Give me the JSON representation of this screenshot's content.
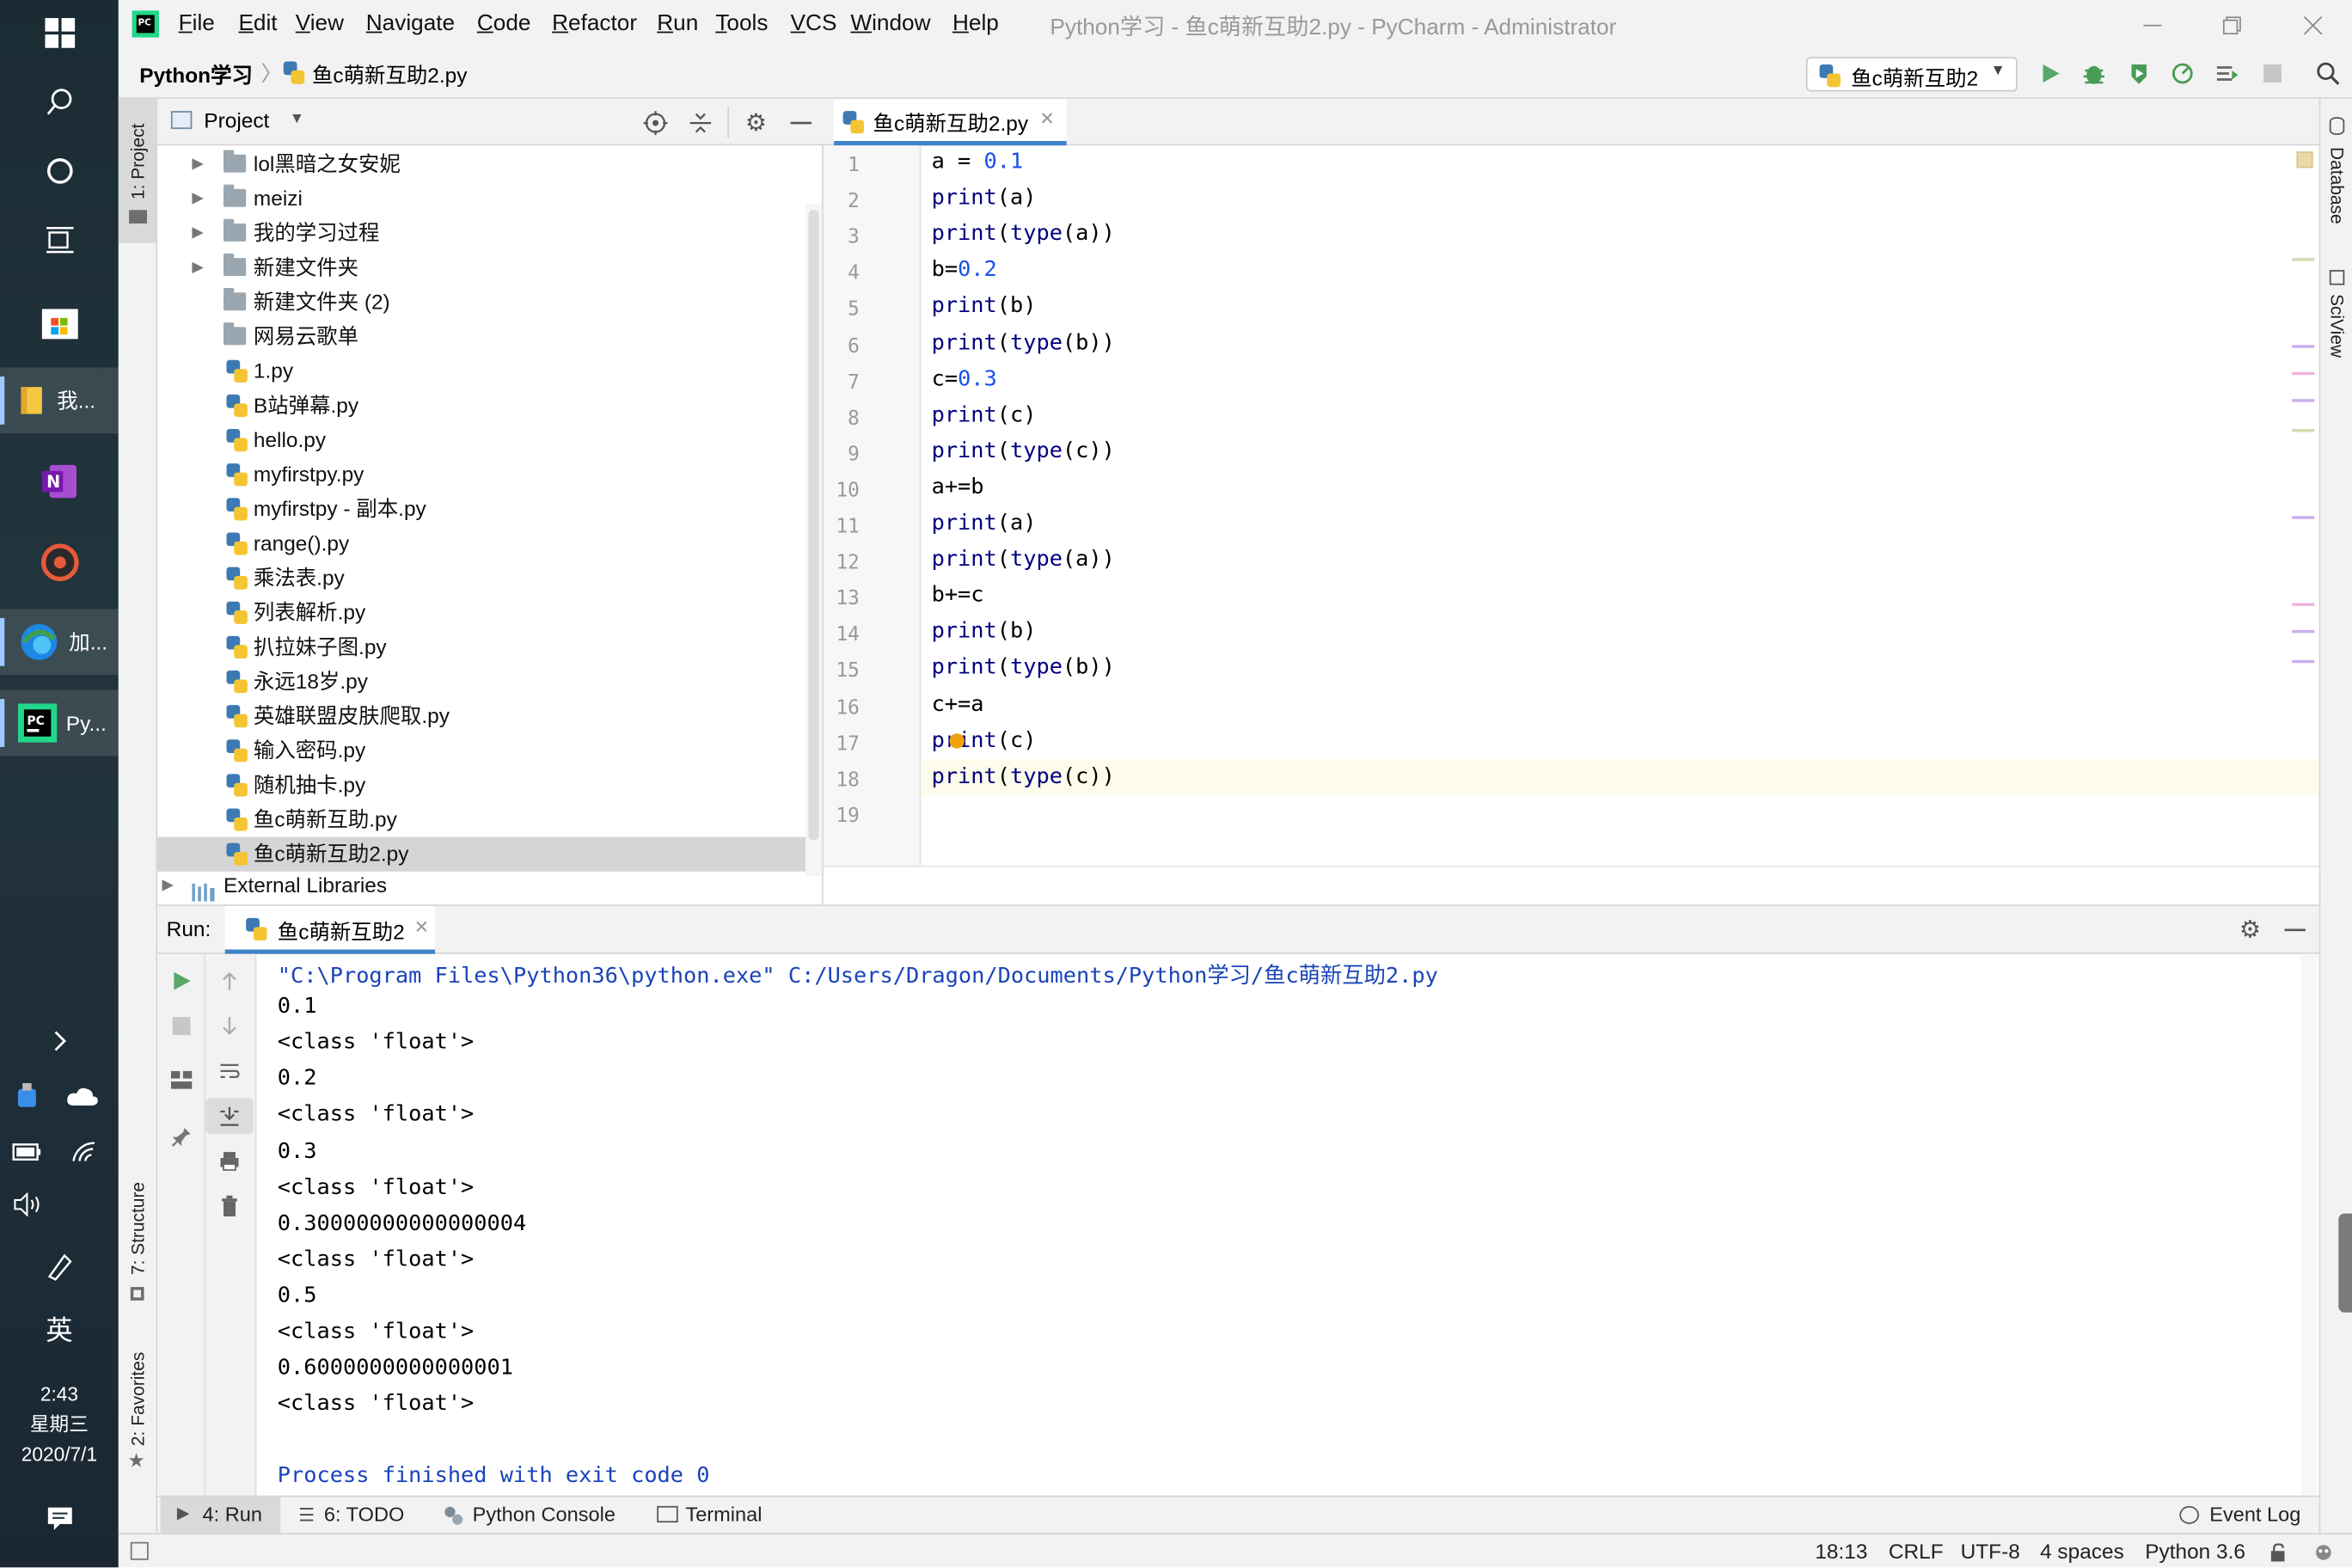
{
  "taskbar": {
    "apps": [
      {
        "label": "我...",
        "icon": "file-explorer-icon"
      },
      {
        "label": "",
        "icon": "onenote-icon"
      },
      {
        "label": "",
        "icon": "music-player-icon"
      },
      {
        "label": "加...",
        "icon": "edge-icon"
      },
      {
        "label": "Py...",
        "icon": "pycharm-icon"
      }
    ],
    "ime": "英",
    "time": "2:43",
    "weekday": "星期三",
    "date": "2020/7/1"
  },
  "titlebar": {
    "menu": [
      {
        "label": "File",
        "u": "F",
        "rest": "ile"
      },
      {
        "label": "Edit",
        "u": "E",
        "rest": "dit"
      },
      {
        "label": "View",
        "u": "V",
        "rest": "iew"
      },
      {
        "label": "Navigate",
        "u": "N",
        "rest": "avigate"
      },
      {
        "label": "Code",
        "u": "C",
        "rest": "ode"
      },
      {
        "label": "Refactor",
        "u": "R",
        "rest": "efactor"
      },
      {
        "label": "Run",
        "u": "R",
        "rest": "un"
      },
      {
        "label": "Tools",
        "u": "T",
        "rest": "ools"
      },
      {
        "label": "VCS",
        "u": "V",
        "rest": "CS"
      },
      {
        "label": "Window",
        "u": "W",
        "rest": "indow"
      },
      {
        "label": "Help",
        "u": "H",
        "rest": "elp"
      }
    ],
    "title": "Python学习 - 鱼c萌新互助2.py - PyCharm - Administrator"
  },
  "navbar": {
    "breadcrumb_project": "Python学习",
    "breadcrumb_file": "鱼c萌新互助2.py",
    "run_config": "鱼c萌新互助2"
  },
  "left_strip": {
    "project_tab": "1: Project",
    "structure_tab": "7: Structure",
    "favorites_tab": "2: Favorites"
  },
  "right_strip": {
    "database_tab": "Database",
    "sciview_tab": "SciView"
  },
  "project_panel": {
    "title": "Project",
    "items": [
      {
        "label": "lol黑暗之女安妮",
        "type": "folder",
        "expandable": true
      },
      {
        "label": "meizi",
        "type": "folder",
        "expandable": true
      },
      {
        "label": "我的学习过程",
        "type": "folder",
        "expandable": true
      },
      {
        "label": "新建文件夹",
        "type": "folder",
        "expandable": true
      },
      {
        "label": "新建文件夹 (2)",
        "type": "folder",
        "expandable": false
      },
      {
        "label": "网易云歌单",
        "type": "folder",
        "expandable": false
      },
      {
        "label": "1.py",
        "type": "py"
      },
      {
        "label": "B站弹幕.py",
        "type": "py"
      },
      {
        "label": "hello.py",
        "type": "py"
      },
      {
        "label": "myfirstpy.py",
        "type": "py"
      },
      {
        "label": "myfirstpy - 副本.py",
        "type": "py"
      },
      {
        "label": "range().py",
        "type": "py"
      },
      {
        "label": "乘法表.py",
        "type": "py"
      },
      {
        "label": "列表解析.py",
        "type": "py"
      },
      {
        "label": "扒拉妹子图.py",
        "type": "py"
      },
      {
        "label": "永远18岁.py",
        "type": "py"
      },
      {
        "label": "英雄联盟皮肤爬取.py",
        "type": "py"
      },
      {
        "label": "输入密码.py",
        "type": "py"
      },
      {
        "label": "随机抽卡.py",
        "type": "py"
      },
      {
        "label": "鱼c萌新互助.py",
        "type": "py"
      },
      {
        "label": "鱼c萌新互助2.py",
        "type": "py",
        "selected": true
      }
    ],
    "external_libraries": "External Libraries"
  },
  "editor": {
    "tab": "鱼c萌新互助2.py",
    "lines": [
      "a = 0.1",
      "print(a)",
      "print(type(a))",
      "b=0.2",
      "print(b)",
      "print(type(b))",
      "c=0.3",
      "print(c)",
      "print(type(c))",
      "a+=b",
      "print(a)",
      "print(type(a))",
      "b+=c",
      "print(b)",
      "print(type(b))",
      "c+=a",
      "print(c)",
      "print(type(c))",
      ""
    ],
    "current_line": 18
  },
  "run_panel": {
    "label": "Run:",
    "tab": "鱼c萌新互助2",
    "output": [
      "\"C:\\Program Files\\Python36\\python.exe\" C:/Users/Dragon/Documents/Python学习/鱼c萌新互助2.py",
      "0.1",
      "<class 'float'>",
      "0.2",
      "<class 'float'>",
      "0.3",
      "<class 'float'>",
      "0.30000000000000004",
      "<class 'float'>",
      "0.5",
      "<class 'float'>",
      "0.6000000000000001",
      "<class 'float'>",
      "",
      "Process finished with exit code 0"
    ]
  },
  "bottom_tabs": {
    "run": "4: Run",
    "todo": "6: TODO",
    "python_console": "Python Console",
    "terminal": "Terminal",
    "event_log": "Event Log"
  },
  "statusbar": {
    "position": "18:13",
    "line_sep": "CRLF",
    "encoding": "UTF-8",
    "indent": "4 spaces",
    "interpreter": "Python 3.6"
  },
  "colors": {
    "number": "#1750eb",
    "builtin": "#000080",
    "output_path": "#1a44b8",
    "run_green": "#59a869",
    "debug_green": "#499c54",
    "current_line": "#fdfbea"
  }
}
